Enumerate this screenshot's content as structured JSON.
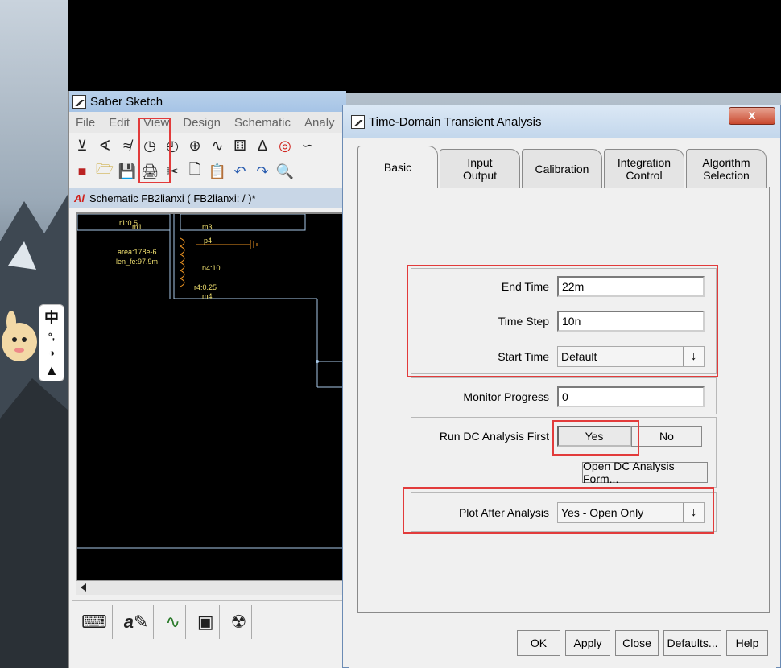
{
  "saber": {
    "title": "Saber Sketch",
    "menu": [
      "File",
      "Edit",
      "View",
      "Design",
      "Schematic",
      "Analy"
    ],
    "schematic_title": "Schematic FB2lianxi ( FB2lianxi: / )*",
    "schematic_labels": {
      "r1": "r1:0.5",
      "m1": "m1",
      "m3": "m3",
      "p4": "p4",
      "area": "area:178e-6",
      "len": "len_fe:97.9m",
      "n4": "n4:10",
      "r4": "r4:0.25",
      "m4": "m4"
    }
  },
  "ime": {
    "chars": [
      "中",
      "°,",
      "◑",
      "👕"
    ]
  },
  "dialog": {
    "title": "Time-Domain Transient Analysis",
    "close_label": "x",
    "tabs": [
      {
        "label": "Basic"
      },
      {
        "label": "Input\nOutput"
      },
      {
        "label": "Calibration"
      },
      {
        "label": "Integration\nControl"
      },
      {
        "label": "Algorithm\nSelection"
      }
    ],
    "fields": {
      "end_time": {
        "label": "End Time",
        "value": "22m"
      },
      "time_step": {
        "label": "Time Step",
        "value": "10n"
      },
      "start_time": {
        "label": "Start Time",
        "value": "Default"
      },
      "monitor_progress": {
        "label": "Monitor Progress",
        "value": "0"
      },
      "run_dc": {
        "label": "Run DC Analysis First",
        "yes": "Yes",
        "no": "No"
      },
      "open_dc_form": "Open DC Analysis Form...",
      "plot_after": {
        "label": "Plot After Analysis",
        "value": "Yes - Open Only"
      }
    },
    "footer": {
      "ok": "OK",
      "apply": "Apply",
      "close": "Close",
      "defaults": "Defaults...",
      "help": "Help"
    }
  },
  "colors": {
    "highlight": "#e23b3b",
    "schematic_bg": "#000000",
    "wire_blue": "#a8c8e8",
    "wire_orange": "#e89020",
    "label_yellow": "#f0e070"
  }
}
